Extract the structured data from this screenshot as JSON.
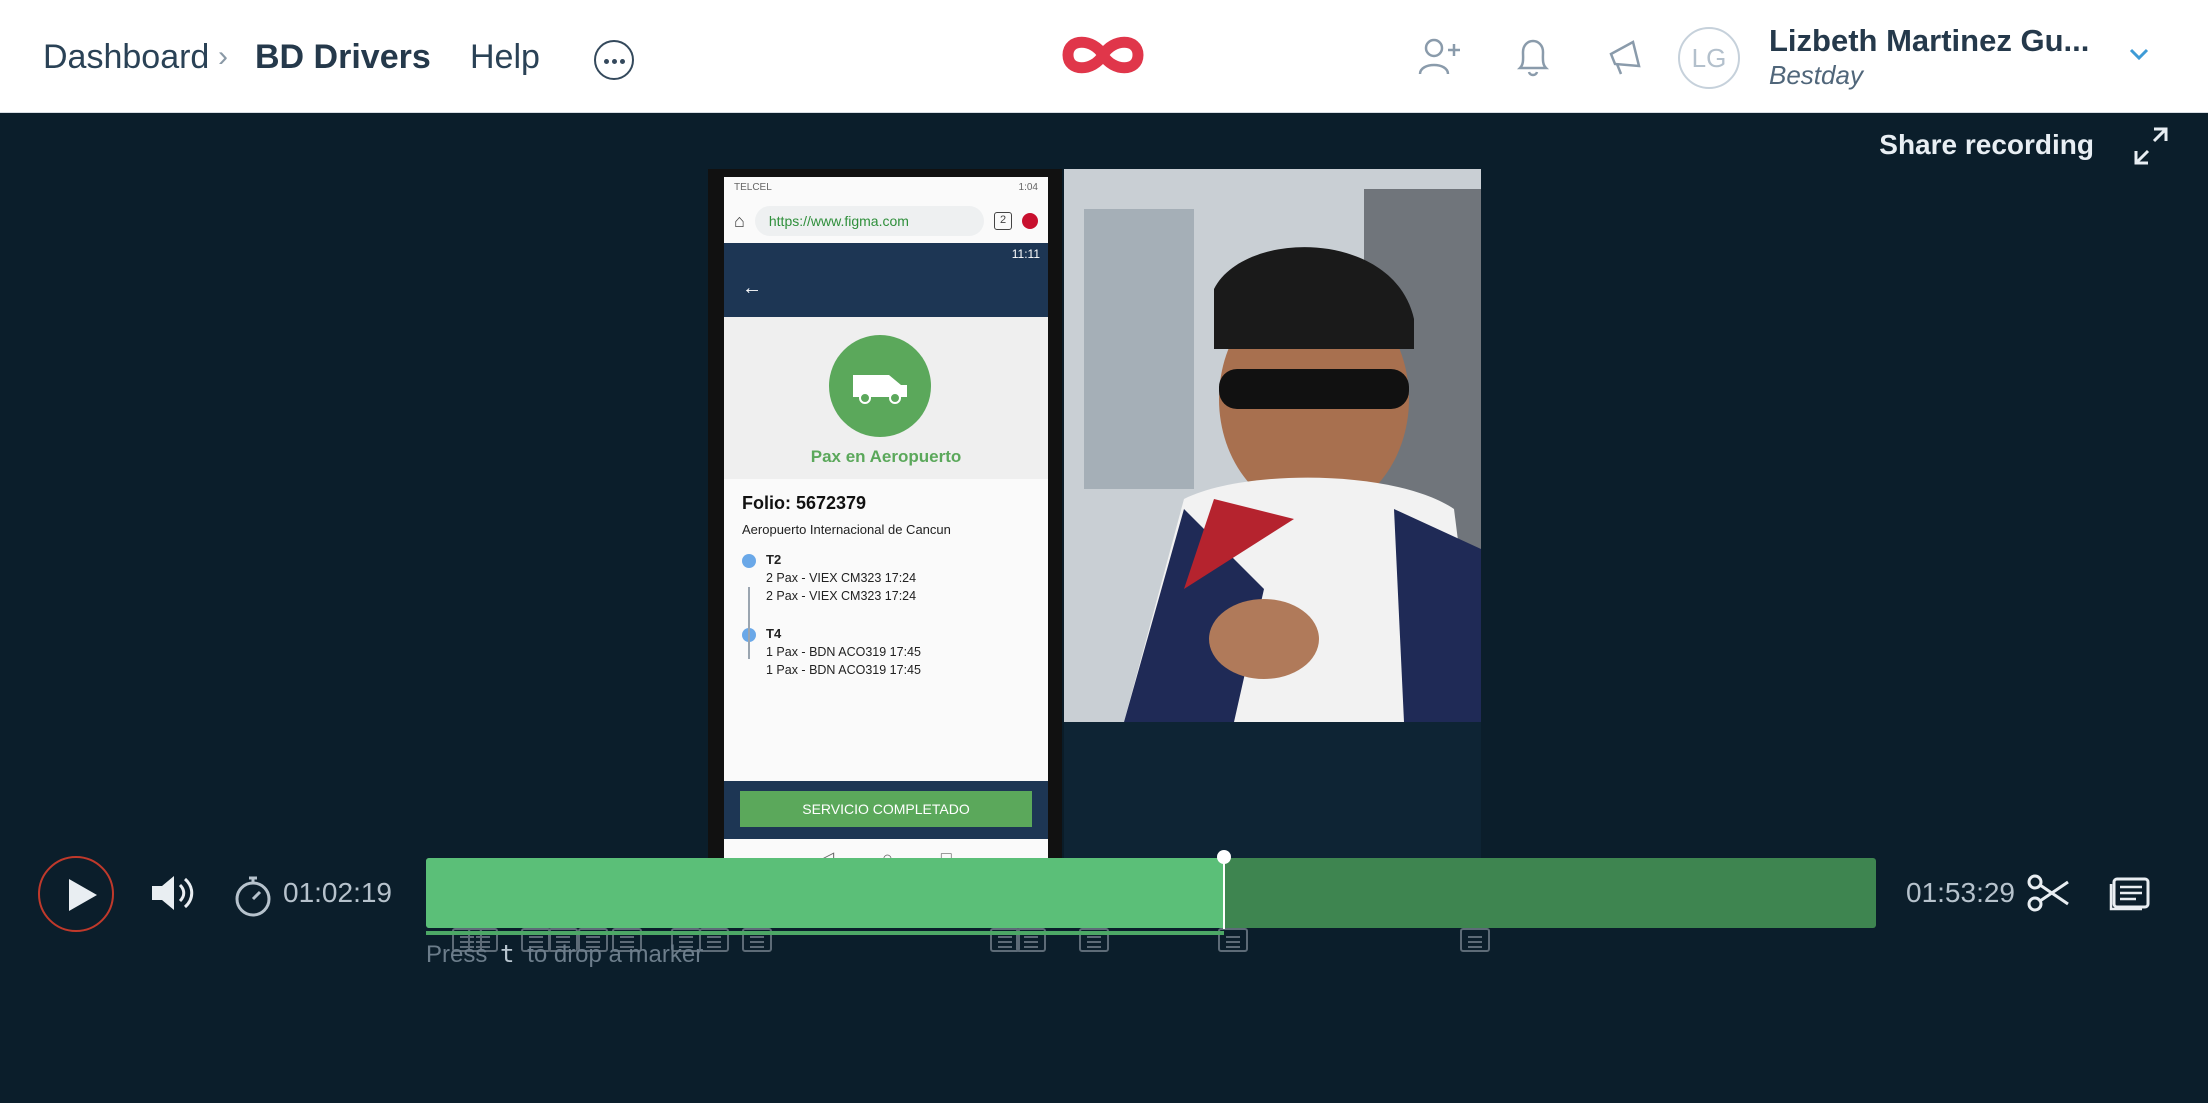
{
  "nav": {
    "breadcrumb_root": "Dashboard",
    "breadcrumb_separator": "›",
    "breadcrumb_current": "BD Drivers",
    "help_label": "Help"
  },
  "user": {
    "initials": "LG",
    "name": "Lizbeth Martinez Gu...",
    "organization": "Bestday"
  },
  "player": {
    "share_label": "Share recording",
    "current_time": "01:02:19",
    "total_time": "01:53:29",
    "progress_fraction": 0.55,
    "hint_prefix": "Press",
    "hint_key": "t",
    "hint_suffix": "to drop a marker"
  },
  "phone_screen": {
    "status_left": "TELCEL",
    "status_right": "1:04",
    "url": "https://www.figma.com",
    "tab_count": "2",
    "app_time": "11:11",
    "status_title": "Pax en Aeropuerto",
    "folio": "Folio: 5672379",
    "location": "Aeropuerto Internacional de Cancun",
    "stops": [
      {
        "terminal": "T2",
        "lines": [
          "2 Pax - VIEX CM323 17:24",
          "2 Pax - VIEX CM323 17:24"
        ]
      },
      {
        "terminal": "T4",
        "lines": [
          "1 Pax - BDN ACO319 17:45",
          "1 Pax - BDN ACO319 17:45"
        ]
      }
    ],
    "cta_label": "SERVICIO COMPLETADO"
  },
  "icons": [
    "more-icon",
    "logo-icon",
    "add-user-icon",
    "bell-icon",
    "announcement-icon",
    "chevron-down-icon",
    "expand-icon",
    "play-icon",
    "volume-icon",
    "timer-icon",
    "scissors-icon",
    "notes-icon",
    "marker-icon",
    "van-icon"
  ],
  "colors": {
    "brand": "#e0364a",
    "stage": "#0b1e2b",
    "timeline_played": "#5bbf78",
    "timeline_remaining": "#3e8550",
    "record_ring": "#c0392b"
  }
}
